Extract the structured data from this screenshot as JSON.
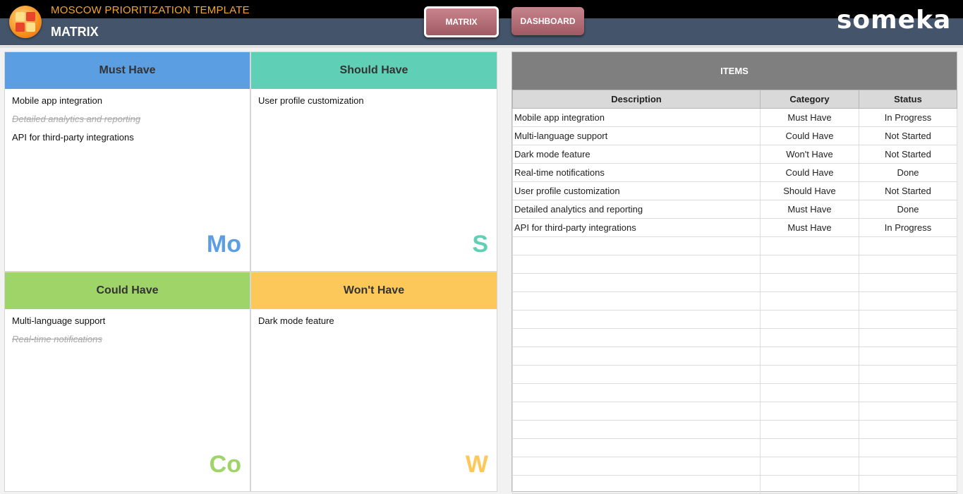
{
  "header": {
    "app_title": "MOSCOW PRIORITIZATION TEMPLATE",
    "page_title": "MATRIX",
    "nav": {
      "matrix": "MATRIX",
      "dashboard": "DASHBOARD"
    },
    "brand": "someka"
  },
  "matrix": {
    "must": {
      "title": "Must Have",
      "letter": "Mo",
      "color": "#5b9ee1",
      "items": [
        {
          "text": "Mobile app integration",
          "done": false
        },
        {
          "text": "Detailed analytics and reporting",
          "done": true
        },
        {
          "text": "API for third-party integrations",
          "done": false
        }
      ]
    },
    "should": {
      "title": "Should Have",
      "letter": "S",
      "color": "#5fd0b6",
      "items": [
        {
          "text": "User profile customization",
          "done": false
        }
      ]
    },
    "could": {
      "title": "Could Have",
      "letter": "Co",
      "color": "#9fd468",
      "items": [
        {
          "text": "Multi-language support",
          "done": false
        },
        {
          "text": "Real-time notifications",
          "done": true
        }
      ]
    },
    "wont": {
      "title": "Won't Have",
      "letter": "W",
      "color": "#fcc85a",
      "items": [
        {
          "text": "Dark mode feature",
          "done": false
        }
      ]
    }
  },
  "items_table": {
    "title": "ITEMS",
    "columns": [
      "Description",
      "Category",
      "Status"
    ],
    "rows": [
      [
        "Mobile app integration",
        "Must Have",
        "In Progress"
      ],
      [
        "Multi-language support",
        "Could Have",
        "Not Started"
      ],
      [
        "Dark mode feature",
        "Won't Have",
        "Not Started"
      ],
      [
        "Real-time notifications",
        "Could Have",
        "Done"
      ],
      [
        "User profile customization",
        "Should Have",
        "Not Started"
      ],
      [
        "Detailed analytics and reporting",
        "Must Have",
        "Done"
      ],
      [
        "API for third-party integrations",
        "Must Have",
        "In Progress"
      ]
    ],
    "empty_rows": 14
  }
}
